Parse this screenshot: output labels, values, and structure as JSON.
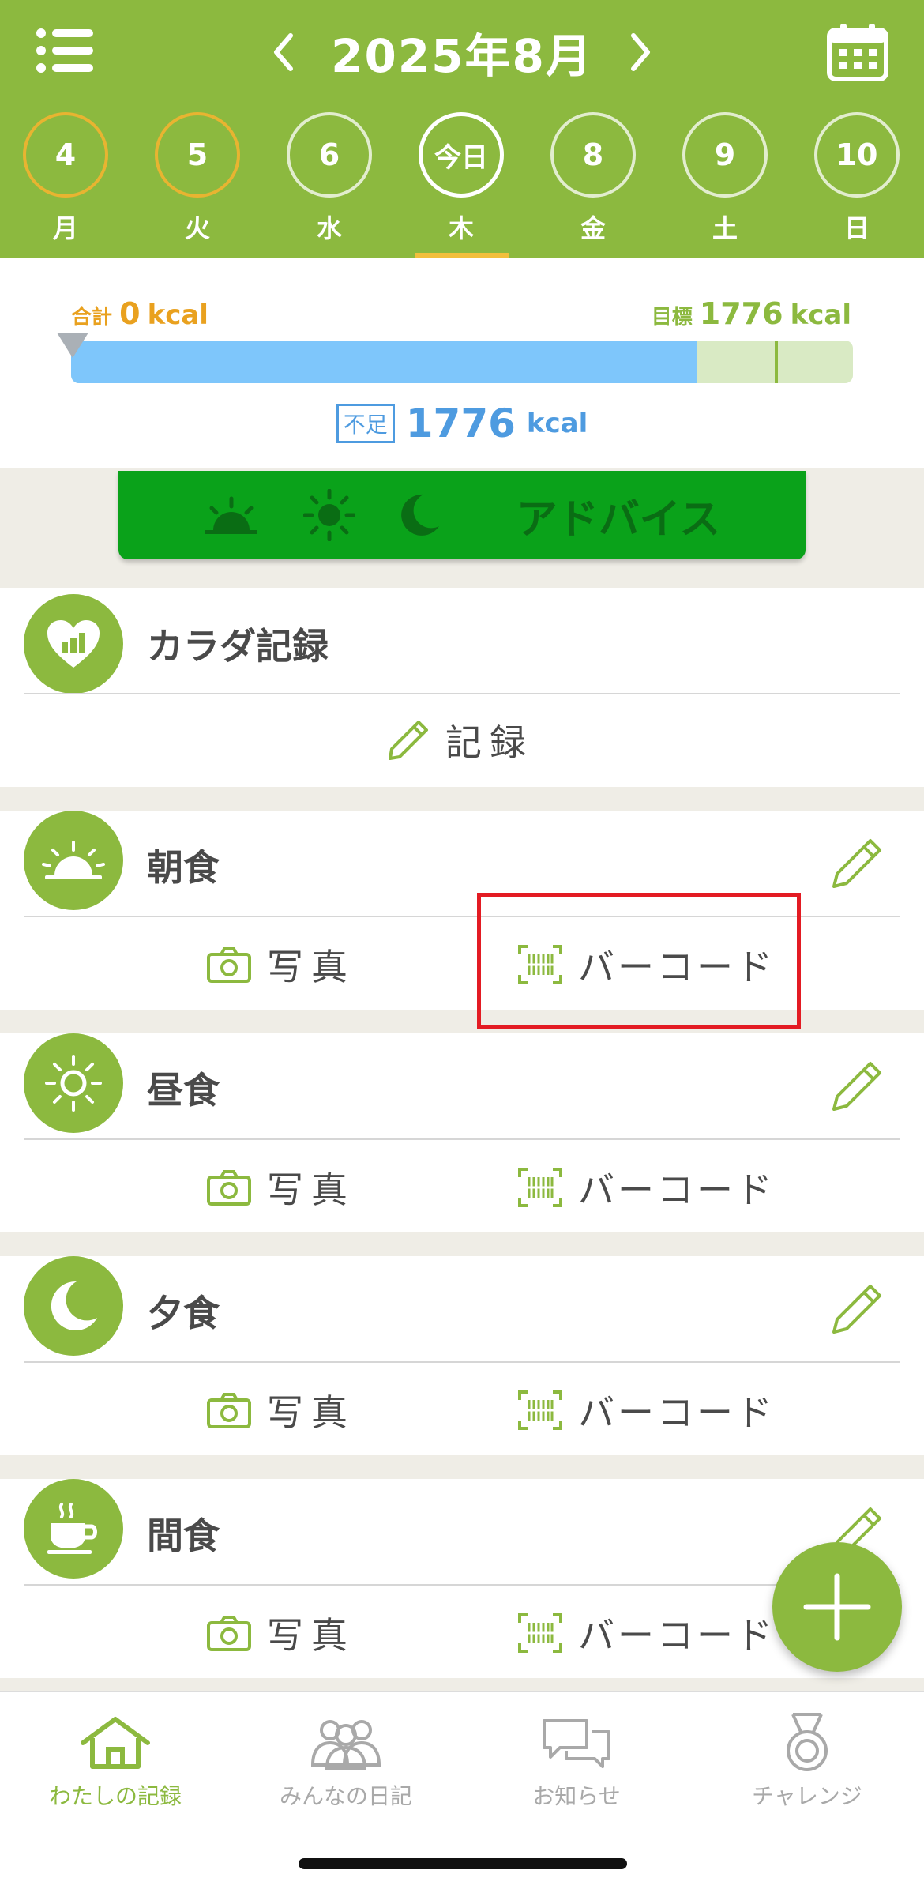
{
  "header": {
    "month_title": "2025年8月",
    "days": [
      {
        "num": "4",
        "dow": "月",
        "ring": "warn"
      },
      {
        "num": "5",
        "dow": "火",
        "ring": "warn"
      },
      {
        "num": "6",
        "dow": "水",
        "ring": "normal"
      },
      {
        "num": "今日",
        "dow": "木",
        "ring": "today"
      },
      {
        "num": "8",
        "dow": "金",
        "ring": "normal"
      },
      {
        "num": "9",
        "dow": "土",
        "ring": "normal"
      },
      {
        "num": "10",
        "dow": "日",
        "ring": "normal"
      }
    ],
    "icons": {
      "menu": "list-icon",
      "calendar": "calendar-icon",
      "prev": "chevron-left-icon",
      "next": "chevron-right-icon"
    }
  },
  "calorie": {
    "total_prefix": "合計",
    "total_value": "0",
    "total_unit": "kcal",
    "goal_prefix": "目標",
    "goal_value": "1776",
    "goal_unit": "kcal",
    "deficit_badge": "不足",
    "deficit_value": "1776",
    "deficit_unit": "kcal",
    "bar_fill_fraction": 0.8,
    "target_marker_fraction": 0.9
  },
  "advice": {
    "label": "アドバイス"
  },
  "body_record": {
    "title": "カラダ記録",
    "record_label": "記録"
  },
  "meals": [
    {
      "title": "朝食",
      "icon": "sunrise-icon"
    },
    {
      "title": "昼食",
      "icon": "sun-icon"
    },
    {
      "title": "夕食",
      "icon": "moon-icon"
    },
    {
      "title": "間食",
      "icon": "coffee-cup-icon"
    }
  ],
  "actions": {
    "photo": "写真",
    "barcode": "バーコード"
  },
  "bottom_nav": [
    {
      "label": "わたしの記録",
      "active": true
    },
    {
      "label": "みんなの日記",
      "active": false
    },
    {
      "label": "お知らせ",
      "active": false
    },
    {
      "label": "チャレンジ",
      "active": false
    }
  ],
  "colors": {
    "brand_green": "#8cb93f",
    "advice_green": "#0aa21a",
    "bar_blue": "#7ec6fb",
    "deficit_blue": "#4e9be0",
    "total_orange": "#e9a11f",
    "highlight_red": "#e31b23"
  }
}
